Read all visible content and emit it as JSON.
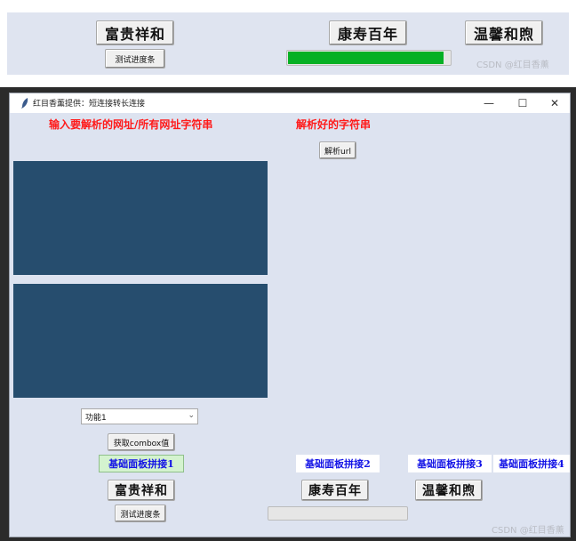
{
  "top_strip": {
    "buttons": {
      "fugui": "富贵祥和",
      "kangshou": "康寿百年",
      "wenxin": "温馨和煦",
      "test_progress": "测试进度条"
    },
    "progress": {
      "value_percent": 96,
      "fill_color": "#06b025"
    },
    "watermark": "CSDN @红目香薰"
  },
  "window": {
    "title": "红目香薰提供：短连接转长连接",
    "controls": {
      "minimize": "—",
      "maximize": "☐",
      "close": "✕"
    },
    "left_label": "输入要解析的网址/所有网址字符串",
    "right_label": "解析好的字符串",
    "parse_button": "解析url",
    "combobox": {
      "selected": "功能1",
      "arrow": "⌄"
    },
    "get_combo_button": "获取combox值",
    "panel_labels": [
      "基础面板拼接1",
      "基础面板拼接2",
      "基础面板拼接3",
      "基础面板拼接4"
    ],
    "bottom_buttons": {
      "fugui": "富贵祥和",
      "kangshou": "康寿百年",
      "wenxin": "温馨和煦",
      "test_progress": "测试进度条"
    },
    "progress": {
      "value_percent": 0
    },
    "watermark": "CSDN @红目香薰",
    "colors": {
      "text_area": "#264d6e",
      "window_bg": "#dde3f0",
      "label_red": "#ff1a1a",
      "label_blue": "#1414e6"
    }
  }
}
